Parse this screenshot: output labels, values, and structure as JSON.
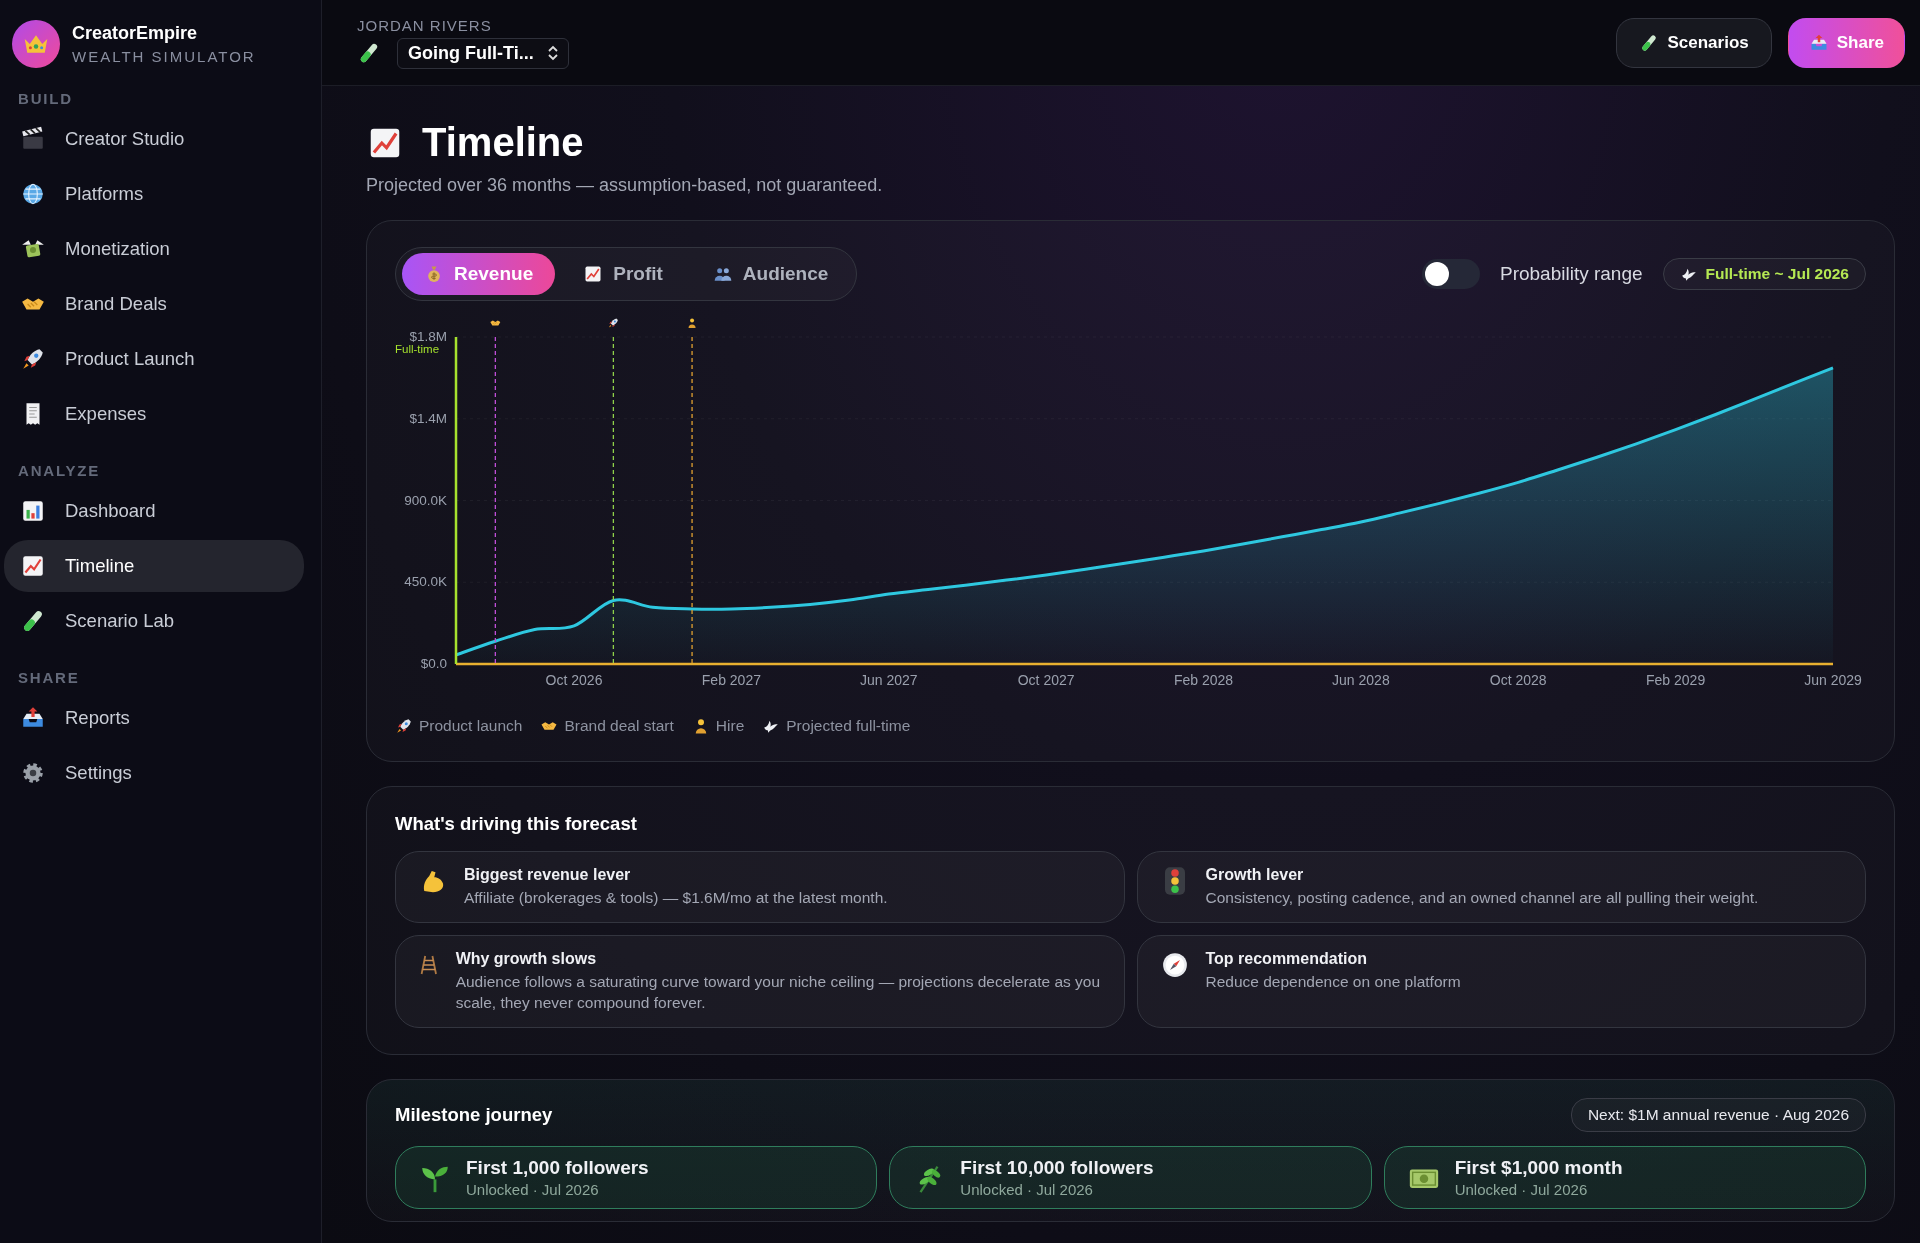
{
  "brand": {
    "name": "CreatorEmpire",
    "tagline": "WEALTH SIMULATOR"
  },
  "sidebar": {
    "sections": [
      {
        "label": "BUILD",
        "items": [
          {
            "label": "Creator Studio",
            "selected": false
          },
          {
            "label": "Platforms",
            "selected": false
          },
          {
            "label": "Monetization",
            "selected": false
          },
          {
            "label": "Brand Deals",
            "selected": false
          },
          {
            "label": "Product Launch",
            "selected": false
          },
          {
            "label": "Expenses",
            "selected": false
          }
        ]
      },
      {
        "label": "ANALYZE",
        "items": [
          {
            "label": "Dashboard",
            "selected": false
          },
          {
            "label": "Timeline",
            "selected": true
          },
          {
            "label": "Scenario Lab",
            "selected": false
          }
        ]
      },
      {
        "label": "SHARE",
        "items": [
          {
            "label": "Reports",
            "selected": false
          },
          {
            "label": "Settings",
            "selected": false
          }
        ]
      }
    ]
  },
  "header": {
    "user": "JORDAN RIVERS",
    "scenario": "Going Full-Ti...",
    "buttons": [
      {
        "label": "Scenarios",
        "kind": "secondary"
      },
      {
        "label": "Share",
        "kind": "primary"
      }
    ]
  },
  "page": {
    "title": "Timeline",
    "subtitle": "Projected over 36 months — assumption-based, not guaranteed."
  },
  "chart_card": {
    "tabs": [
      {
        "label": "Revenue",
        "selected": true
      },
      {
        "label": "Profit",
        "selected": false
      },
      {
        "label": "Audience",
        "selected": false
      }
    ],
    "toggle": {
      "label": "Probability range",
      "on": false
    },
    "badge": "Full-time ~ Jul 2026",
    "chart_data": {
      "type": "area",
      "categories": [
        null,
        null,
        null,
        "Oct 2026",
        null,
        null,
        null,
        "Feb 2027",
        null,
        null,
        null,
        "Jun 2027",
        null,
        null,
        null,
        "Oct 2027",
        null,
        null,
        null,
        "Feb 2028",
        null,
        null,
        null,
        "Jun 2028",
        null,
        null,
        null,
        "Oct 2028",
        null,
        null,
        null,
        "Feb 2029",
        null,
        null,
        null,
        "Jun 2029"
      ],
      "grid": true,
      "series": [
        {
          "color": "#2ec8e0",
          "values": [
            50000,
            125000,
            190000,
            210000,
            350000,
            312000,
            303000,
            303000,
            312000,
            328000,
            352000,
            385000,
            410000,
            435000,
            462000,
            490000,
            522000,
            555000,
            588000,
            622000,
            660000,
            700000,
            740000,
            782000,
            832000,
            884000,
            940000,
            1000000,
            1068000,
            1138000,
            1212000,
            1290000,
            1372000,
            1458000,
            1545000,
            1630000
          ]
        }
      ],
      "ylim": [
        0,
        1800000
      ],
      "yticks": [
        {
          "value": 0,
          "label": "$0.0"
        },
        {
          "value": 450000,
          "label": "450.0K"
        },
        {
          "value": 900000,
          "label": "900.0K"
        },
        {
          "value": 1350000,
          "label": "$1.4M"
        },
        {
          "value": 1800000,
          "label": "$1.8M"
        }
      ]
    },
    "axis_note": "Full-time",
    "legend": [
      "Product launch",
      "Brand deal start",
      "Hire",
      "Projected full-time"
    ]
  },
  "forecast": {
    "title": "What's driving this forecast",
    "cards": [
      {
        "title": "Biggest revenue lever",
        "text": "Affiliate (brokerages & tools) — $1.6M/mo at the latest month."
      },
      {
        "title": "Growth lever",
        "text": "Consistency, posting cadence, and an owned channel are all pulling their weight."
      },
      {
        "title": "Why growth slows",
        "text": "Audience follows a saturating curve toward your niche ceiling — projections decelerate as you scale, they never compound forever."
      },
      {
        "title": "Top recommendation",
        "text": "Reduce dependence on one platform"
      }
    ]
  },
  "milestones": {
    "title": "Milestone journey",
    "next": "Next: $1M annual revenue · Aug 2026",
    "items": [
      {
        "title": "First 1,000 followers",
        "status": "Unlocked · Jul 2026"
      },
      {
        "title": "First 10,000 followers",
        "status": "Unlocked · Jul 2026"
      },
      {
        "title": "First $1,000 month",
        "status": "Unlocked · Jul 2026"
      }
    ]
  }
}
